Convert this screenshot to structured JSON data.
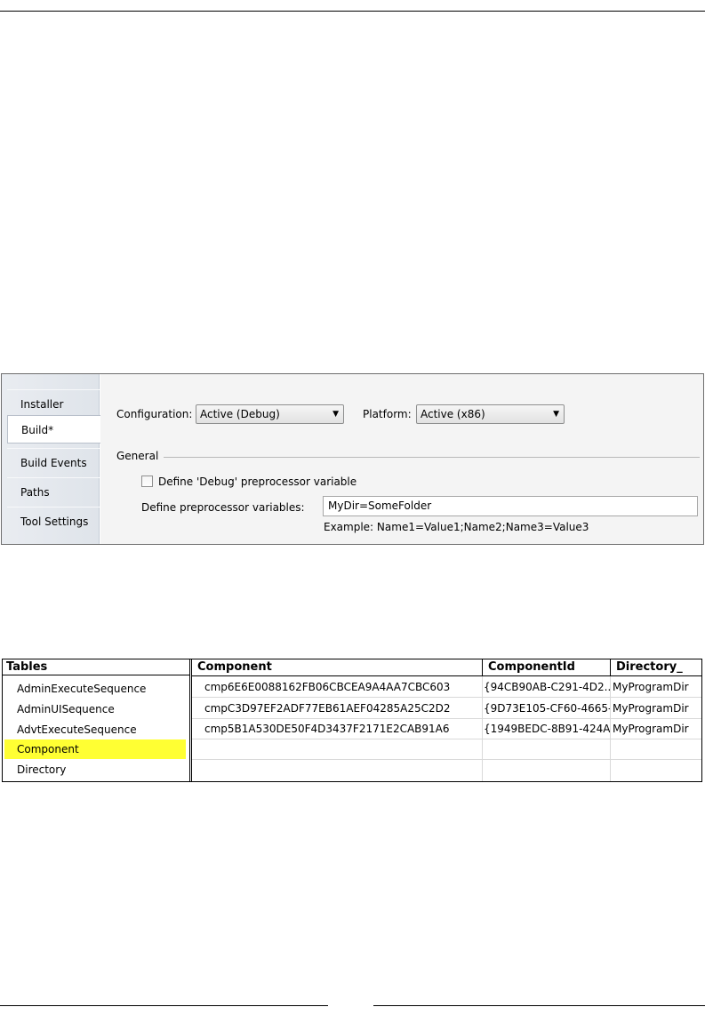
{
  "properties": {
    "tabs": [
      {
        "label": "Installer",
        "active": false
      },
      {
        "label": "Build*",
        "active": true
      },
      {
        "label": "Build Events",
        "active": false
      },
      {
        "label": "Paths",
        "active": false
      },
      {
        "label": "Tool Settings",
        "active": false
      }
    ],
    "configuration": {
      "label": "Configuration:",
      "value": "Active (Debug)"
    },
    "platform": {
      "label": "Platform:",
      "value": "Active (x86)"
    },
    "general": {
      "title": "General",
      "define_debug": {
        "label": "Define 'Debug' preprocessor variable",
        "checked": false
      },
      "preprocessor": {
        "label": "Define preprocessor variables:",
        "value": "MyDir=SomeFolder"
      },
      "example": "Example: Name1=Value1;Name2;Name3=Value3"
    }
  },
  "grid": {
    "tables_header": "Tables",
    "tables": [
      {
        "label": "AdminExecuteSequence",
        "selected": false
      },
      {
        "label": "AdminUISequence",
        "selected": false
      },
      {
        "label": "AdvtExecuteSequence",
        "selected": false
      },
      {
        "label": "Component",
        "selected": true
      },
      {
        "label": "Directory",
        "selected": false
      }
    ],
    "columns": [
      "Component",
      "ComponentId",
      "Directory_"
    ],
    "rows": [
      [
        "cmp6E6E0088162FB06CBCEA9A4AA7CBC603",
        "{94CB90AB-C291-4D2...",
        "MyProgramDir"
      ],
      [
        "cmpC3D97EF2ADF77EB61AEF04285A25C2D2",
        "{9D73E105-CF60-4665-...",
        "MyProgramDir"
      ],
      [
        "cmp5B1A530DE50F4D3437F2171E2CAB91A6",
        "{1949BEDC-8B91-424A...",
        "MyProgramDir"
      ]
    ],
    "selected_color": "#ffff33"
  }
}
